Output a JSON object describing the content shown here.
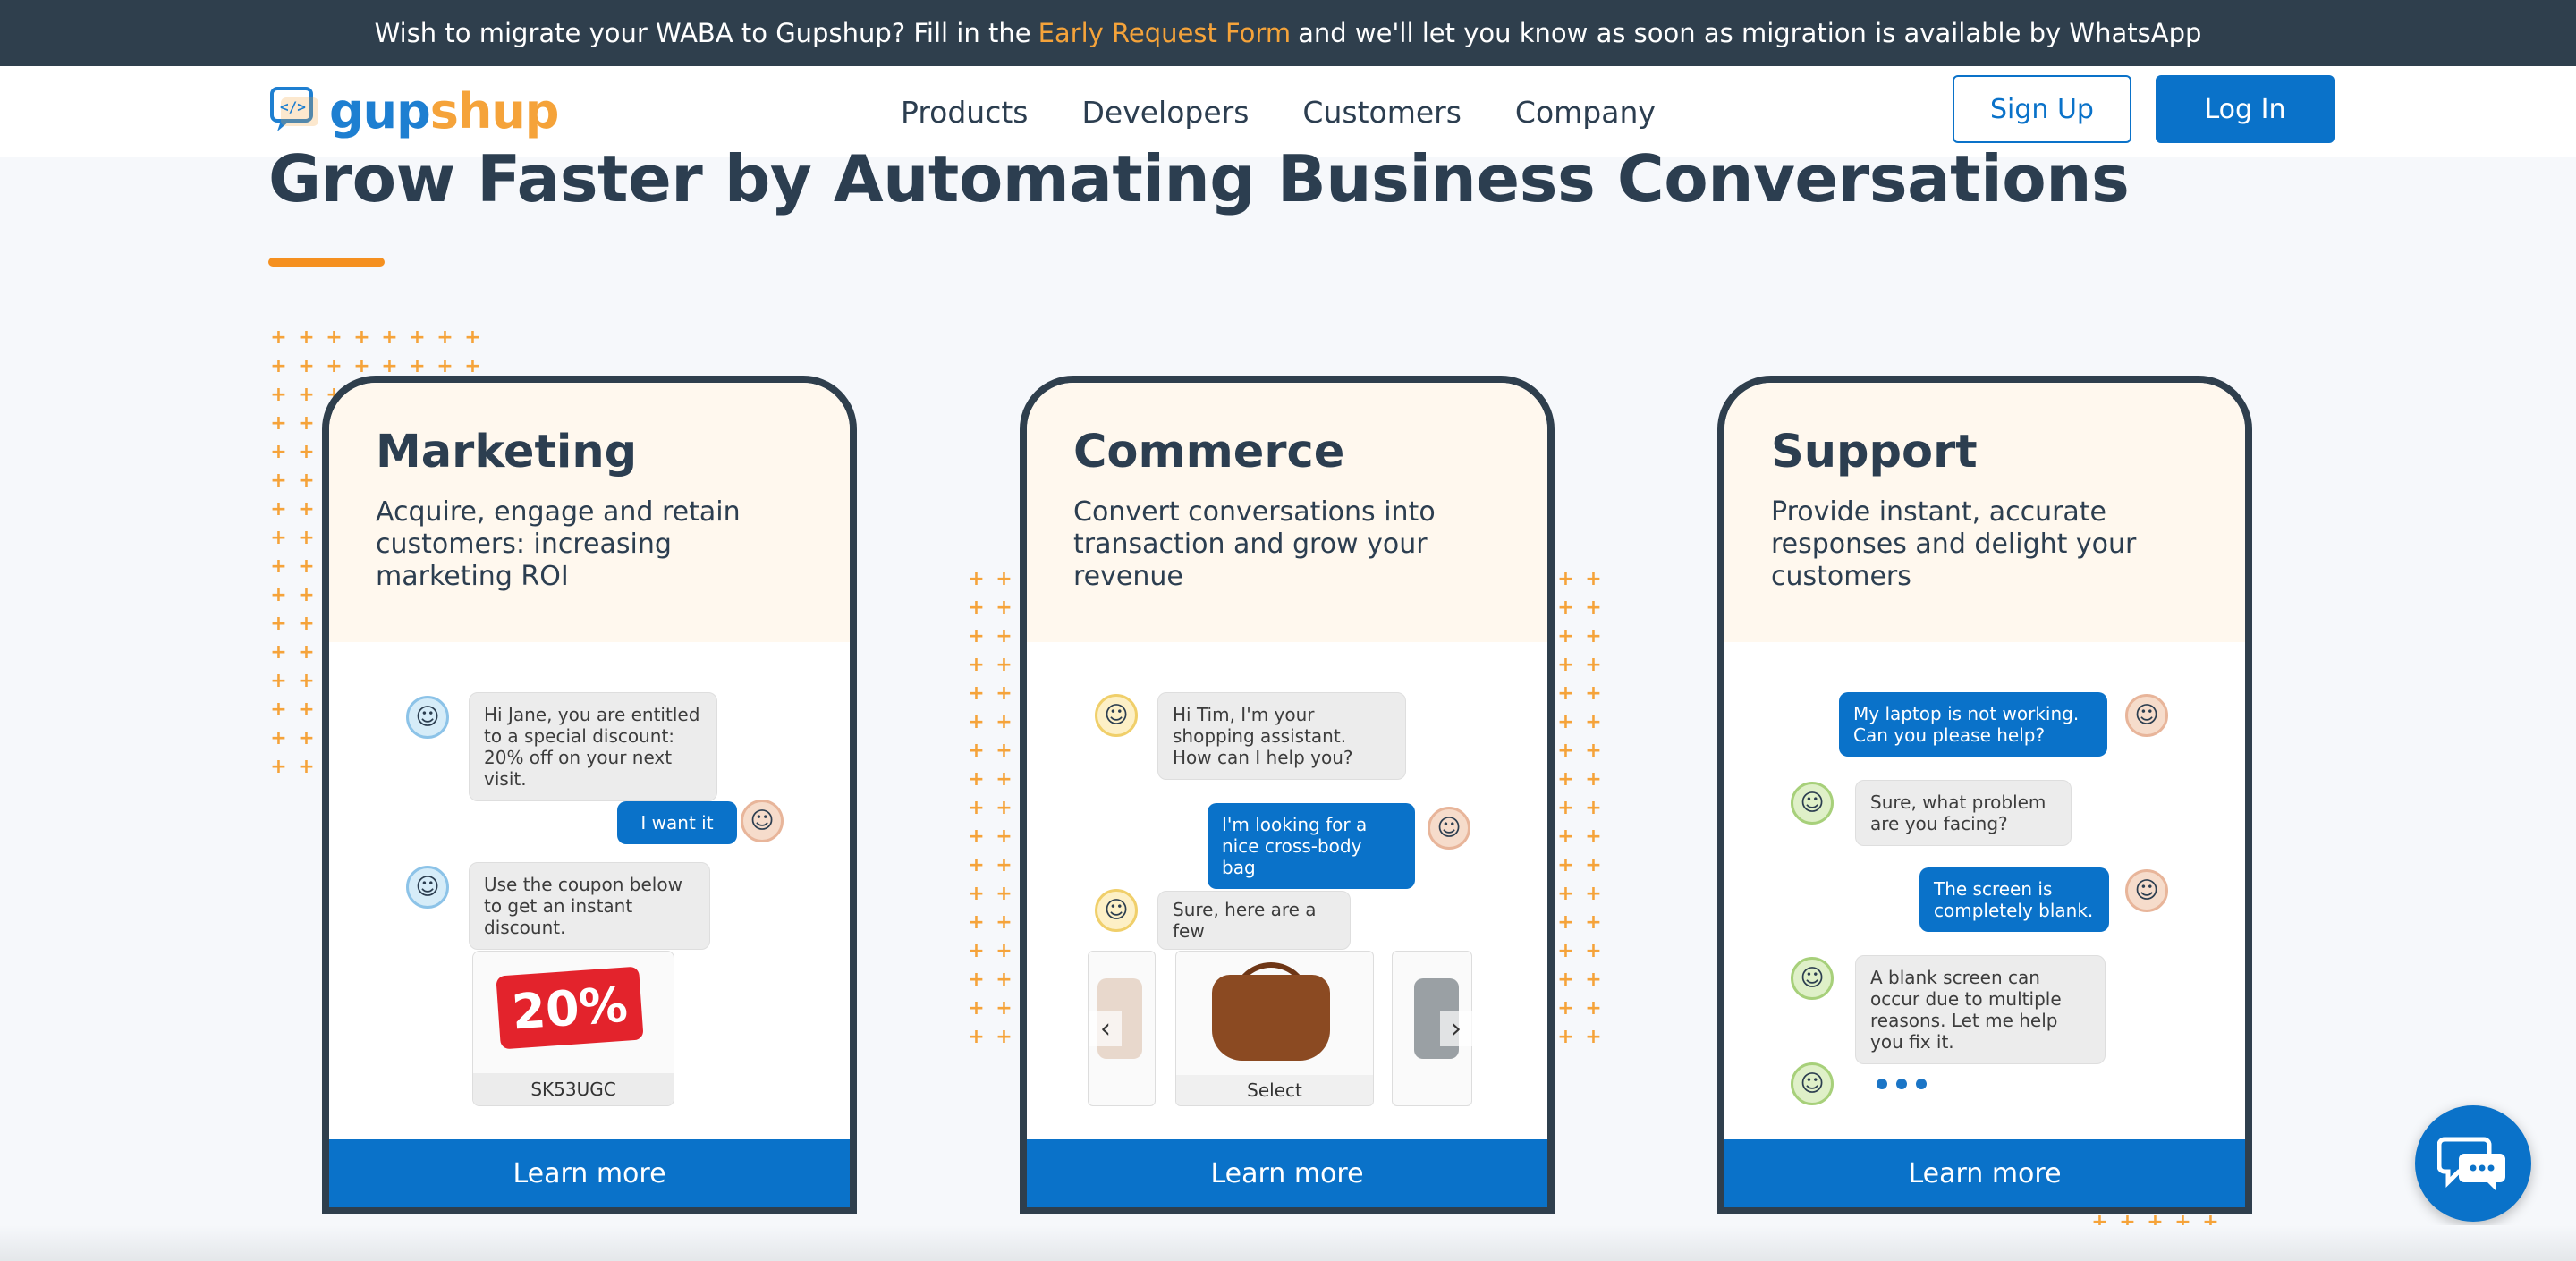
{
  "banner": {
    "text_before": "Wish to migrate your WABA to Gupshup? Fill in the",
    "link": "Early Request Form",
    "text_after": "and we'll let you know as soon as migration is available by WhatsApp"
  },
  "nav": {
    "logo_part1": "gup",
    "logo_part2": "shup",
    "items": [
      "Products",
      "Developers",
      "Customers",
      "Company"
    ],
    "signup": "Sign Up",
    "login": "Log In"
  },
  "hero": {
    "headline": "Grow Faster by Automating Business Conversations"
  },
  "cards": [
    {
      "title": "Marketing",
      "description": "Acquire, engage and retain customers: increasing marketing ROI",
      "button": "Learn more",
      "chat": {
        "msg1": "Hi Jane, you are entitled to a special discount: 20% off on your next visit.",
        "msg2": "I want it",
        "msg3": "Use the coupon below to get an instant discount.",
        "coupon_percent": "20%",
        "coupon_code": "SK53UGC"
      }
    },
    {
      "title": "Commerce",
      "description": "Convert conversations into transaction and grow your revenue",
      "button": "Learn more",
      "chat": {
        "msg1": "Hi Tim, I'm your shopping assistant. How can I help you?",
        "msg2": "I'm looking for a nice cross-body bag",
        "msg3": "Sure, here are a few",
        "product_label": "Select"
      }
    },
    {
      "title": "Support",
      "description": "Provide instant, accurate responses and delight your customers",
      "button": "Learn more",
      "chat": {
        "msg1": "My laptop is not working. Can you please help?",
        "msg2": "Sure, what problem are you facing?",
        "msg3": "The screen is completely blank.",
        "msg4": "A blank screen can occur due to multiple reasons. Let me help you fix it."
      }
    }
  ],
  "colors": {
    "banner_bg": "#2f3f4d",
    "accent_orange": "#f5a33a",
    "primary_blue": "#0a72c9",
    "text_dark": "#2c3e50"
  }
}
